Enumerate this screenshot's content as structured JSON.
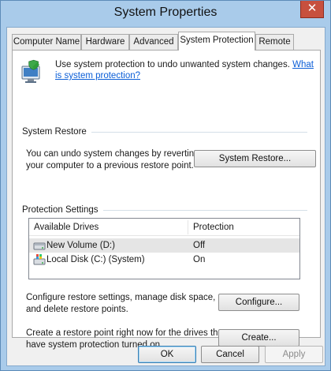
{
  "window": {
    "title": "System Properties",
    "close_glyph": "✕"
  },
  "tabs": [
    {
      "label": "Computer Name",
      "active": false
    },
    {
      "label": "Hardware",
      "active": false
    },
    {
      "label": "Advanced",
      "active": false
    },
    {
      "label": "System Protection",
      "active": true
    },
    {
      "label": "Remote",
      "active": false
    }
  ],
  "intro": {
    "text": "Use system protection to undo unwanted system changes.",
    "link": "What is system protection?"
  },
  "system_restore": {
    "group_title": "System Restore",
    "description_line1": "You can undo system changes by reverting",
    "description_line2": "your computer to a previous restore point.",
    "button_label": "System Restore..."
  },
  "protection_settings": {
    "group_title": "Protection Settings",
    "columns": [
      "Available Drives",
      "Protection"
    ],
    "drives": [
      {
        "name": "New Volume (D:)",
        "protection": "Off",
        "icon": "drive-icon",
        "selected": true
      },
      {
        "name": "Local Disk (C:) (System)",
        "protection": "On",
        "icon": "system-drive-icon",
        "selected": false
      }
    ],
    "configure_desc_line1": "Configure restore settings, manage disk space,",
    "configure_desc_line2": "and delete restore points.",
    "configure_label": "Configure...",
    "create_desc_line1": "Create a restore point right now for the drives that",
    "create_desc_line2": "have system protection turned on.",
    "create_label": "Create..."
  },
  "footer": {
    "ok_label": "OK",
    "cancel_label": "Cancel",
    "apply_label": "Apply"
  },
  "colors": {
    "frame": "#a9cbea",
    "close_button": "#c7503e",
    "link": "#0b5ed7",
    "selected_row": "#e5e5e5"
  }
}
